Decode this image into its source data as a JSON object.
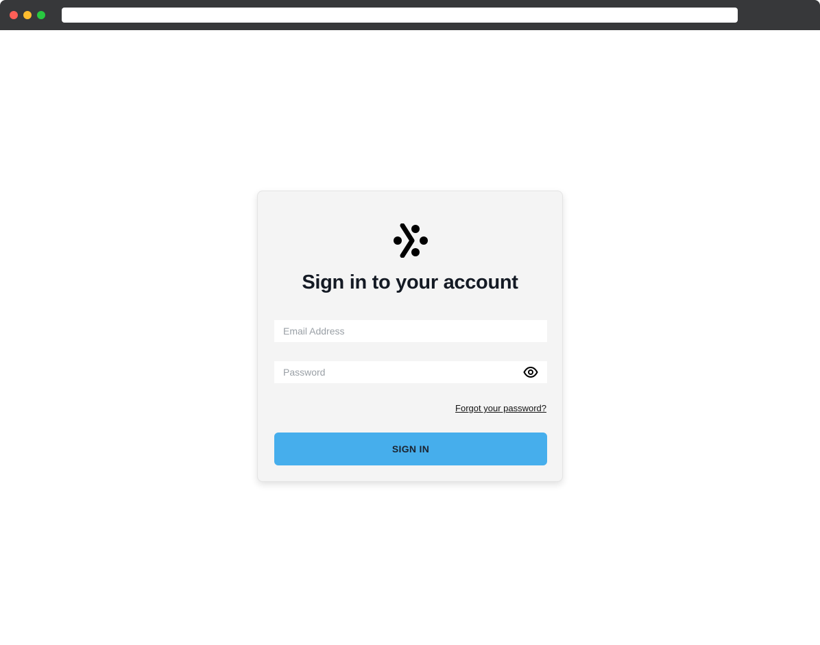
{
  "browser": {
    "traffic_lights": {
      "close_color": "#ff5f57",
      "minimize_color": "#febc2e",
      "maximize_color": "#28c840"
    },
    "address_bar_value": ""
  },
  "login": {
    "logo_icon": "brand-dots-chevron-icon",
    "title": "Sign in to your account",
    "email": {
      "placeholder": "Email Address",
      "value": ""
    },
    "password": {
      "placeholder": "Password",
      "value": "",
      "toggle_icon": "eye-icon"
    },
    "forgot_link": "Forgot your password?",
    "submit_label": "SIGN IN"
  },
  "colors": {
    "accent": "#46aeec",
    "card_background": "#f4f4f4",
    "chrome": "#37383a",
    "title_text": "#141a24"
  }
}
